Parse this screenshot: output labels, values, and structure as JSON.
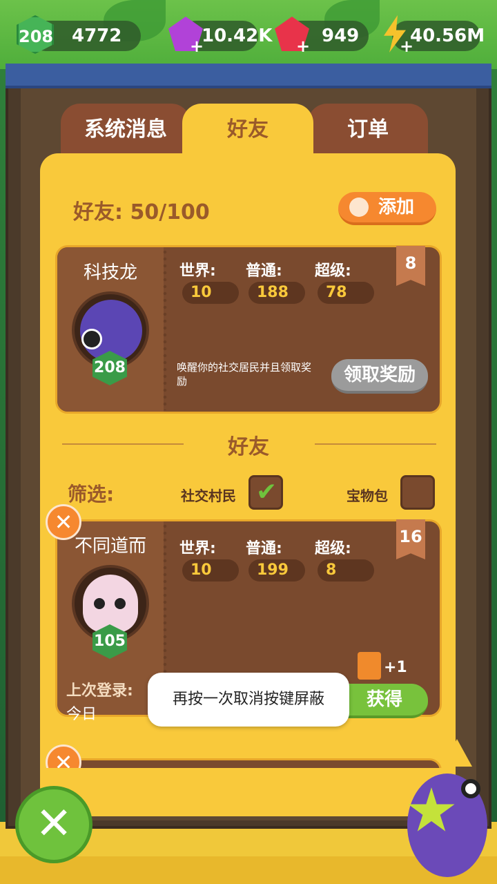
{
  "currencies": {
    "level": "208",
    "coins": "4772",
    "purple_gems": "10.42K",
    "red_gems": "949",
    "energy": "40.56M"
  },
  "tabs": [
    {
      "label": "系统消息",
      "active": false
    },
    {
      "label": "好友",
      "active": true
    },
    {
      "label": "订单",
      "active": false
    }
  ],
  "friends_header": {
    "count_label": "好友: 50/100",
    "add_button": "添加"
  },
  "self_card": {
    "name": "科技龙",
    "level": "208",
    "ribbon": "8",
    "stats": {
      "world_label": "世界:",
      "world_value": "10",
      "normal_label": "普通:",
      "normal_value": "188",
      "super_label": "超级:",
      "super_value": "78"
    },
    "description": "唤醒你的社交居民并且领取奖励",
    "claim_button": "领取奖励"
  },
  "section_title": "好友",
  "filter": {
    "label": "筛选:",
    "option1": "社交村民",
    "option1_checked": true,
    "option2": "宝物包",
    "option2_checked": false
  },
  "friend_card": {
    "name": "不同道而",
    "level": "105",
    "ribbon": "16",
    "stats": {
      "world_label": "世界:",
      "world_value": "10",
      "normal_label": "普通:",
      "normal_value": "199",
      "super_label": "超级:",
      "super_value": "8"
    },
    "last_login_label": "上次登录:",
    "last_login_value": "今日",
    "reward_count": "+1",
    "get_button": "获得"
  },
  "toast": "再按一次取消按键屏蔽",
  "colors": {
    "panel": "#f9c93b",
    "card": "#7a4a2e",
    "accent_orange": "#f6882f",
    "accent_green": "#78c23c"
  }
}
